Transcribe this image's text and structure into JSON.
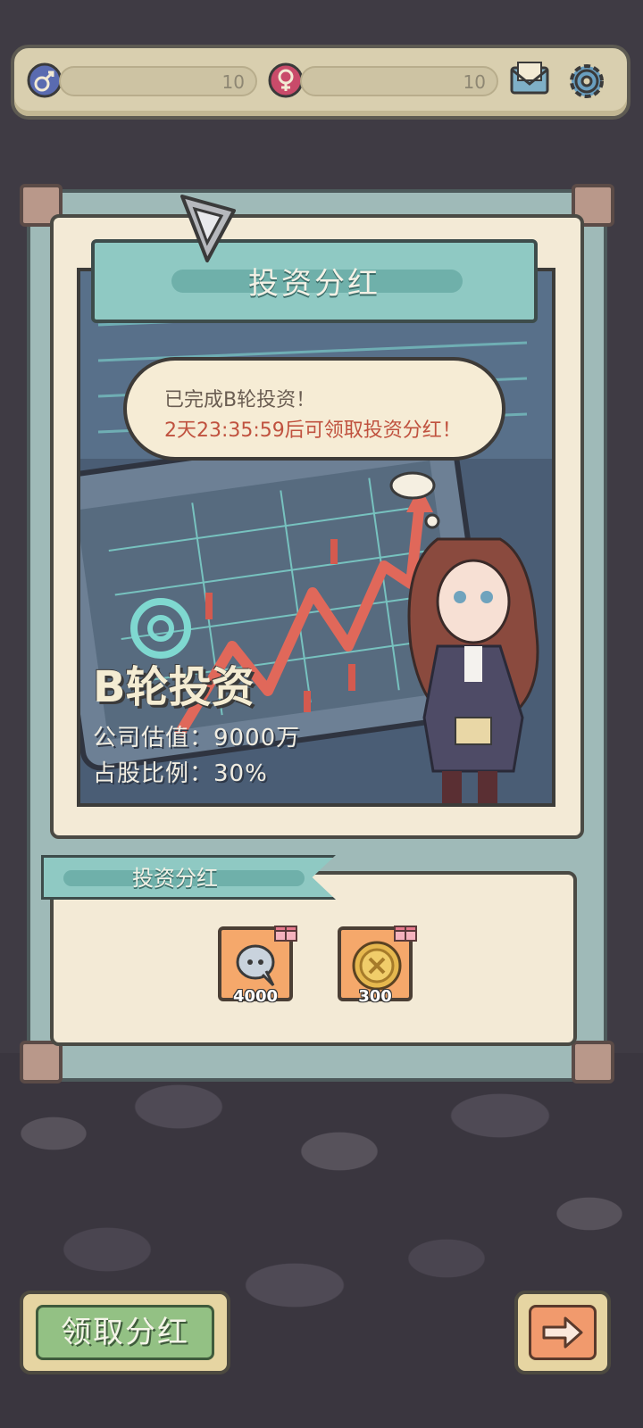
{
  "colors": {
    "panel_teal": "#8fc9c3",
    "paper": "#f3ead6",
    "accent_red": "#c0523f",
    "claim_green": "#93c184",
    "next_orange": "#f19a6d"
  },
  "topbar": {
    "male_icon": "male-symbol-icon",
    "male_value": "10",
    "female_icon": "female-symbol-icon",
    "female_value": "10",
    "mail_icon": "mail-icon",
    "settings_icon": "gear-icon"
  },
  "panel": {
    "title": "投资分红",
    "bubble_line1": "已完成B轮投资！",
    "bubble_line2": "2天23:35:59后可领取投资分红！",
    "round_title": "B轮投资",
    "valuation": "公司估值：9000万",
    "share_ratio": "占股比例：30%"
  },
  "rewards": {
    "label": "投资分红",
    "items": [
      {
        "icon": "speech-bubble-icon",
        "count": "4000"
      },
      {
        "icon": "coin-icon",
        "count": "300"
      }
    ]
  },
  "footer": {
    "claim_label": "领取分红",
    "next_icon": "arrow-right-icon"
  }
}
